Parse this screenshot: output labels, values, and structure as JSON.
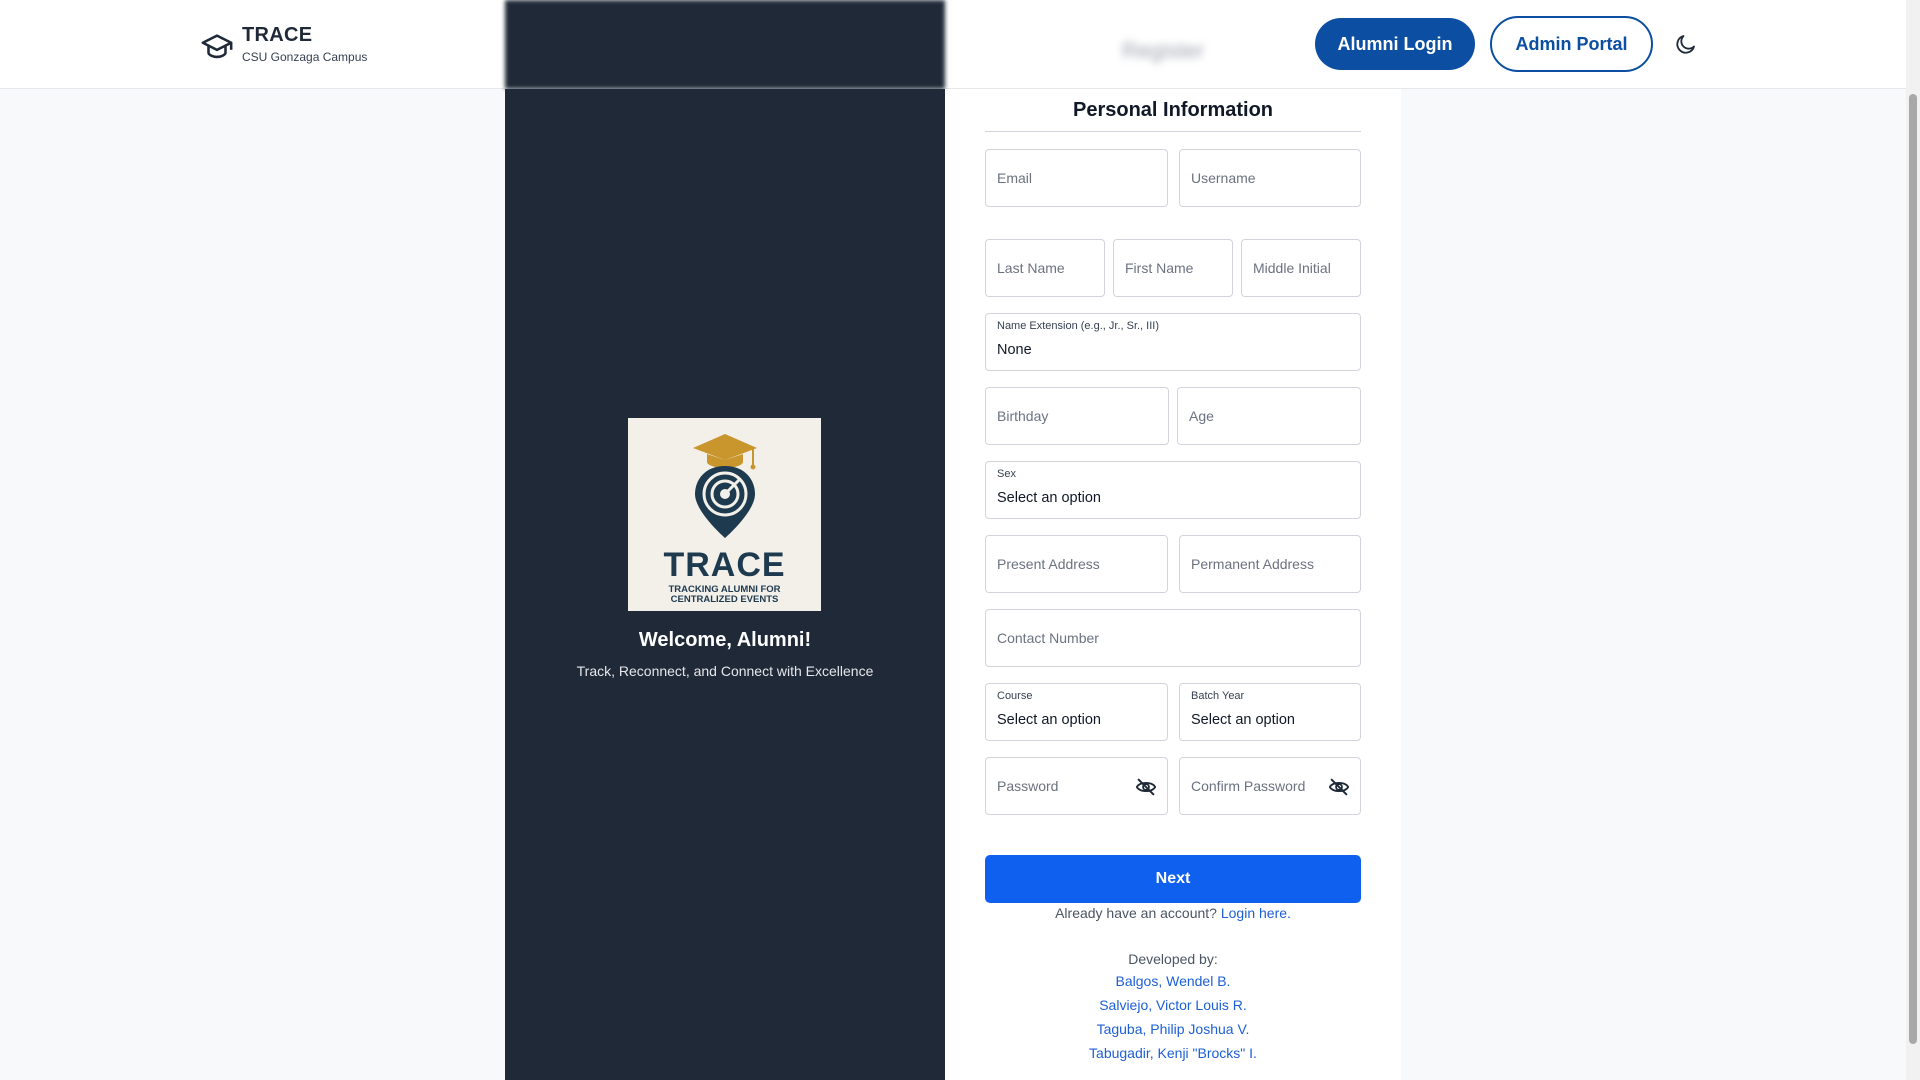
{
  "header": {
    "brand_title": "TRACE",
    "brand_subtitle": "CSU Gonzaga Campus",
    "blurred_tab": "Register",
    "alumni_login": "Alumni Login",
    "admin_portal": "Admin Portal",
    "theme_icon": "moon-icon"
  },
  "hero": {
    "logo_title": "TRACE",
    "logo_tagline": "TRACKING ALUMNI FOR CENTRALIZED EVENTS",
    "welcome": "Welcome, Alumni!",
    "tagline": "Track, Reconnect, and Connect with Excellence"
  },
  "form": {
    "title": "Personal Information",
    "email_placeholder": "Email",
    "username_placeholder": "Username",
    "last_name_placeholder": "Last Name",
    "first_name_placeholder": "First Name",
    "middle_initial_placeholder": "Middle Initial",
    "name_extension_label": "Name Extension (e.g., Jr., Sr., III)",
    "name_extension_value": "None",
    "birthday_placeholder": "Birthday",
    "age_placeholder": "Age",
    "sex_label": "Sex",
    "sex_value": "Select an option",
    "present_address_placeholder": "Present Address",
    "permanent_address_placeholder": "Permanent Address",
    "contact_number_placeholder": "Contact Number",
    "course_label": "Course",
    "course_value": "Select an option",
    "batch_year_label": "Batch Year",
    "batch_year_value": "Select an option",
    "password_placeholder": "Password",
    "confirm_password_placeholder": "Confirm Password",
    "next_button": "Next",
    "account_prompt": "Already have an account?",
    "login_link": "Login here."
  },
  "developers": {
    "title": "Developed by:",
    "names": [
      "Balgos, Wendel B.",
      "Salviejo, Victor Louis R.",
      "Taguba, Philip Joshua V.",
      "Tabugadir, Kenji \"Brocks\" I."
    ]
  },
  "colors": {
    "primary": "#0b4ea2",
    "next_button": "#1060f0",
    "dark_panel": "#1f2937",
    "logo_gold": "#c8962c",
    "logo_navy": "#1e3a4f"
  }
}
